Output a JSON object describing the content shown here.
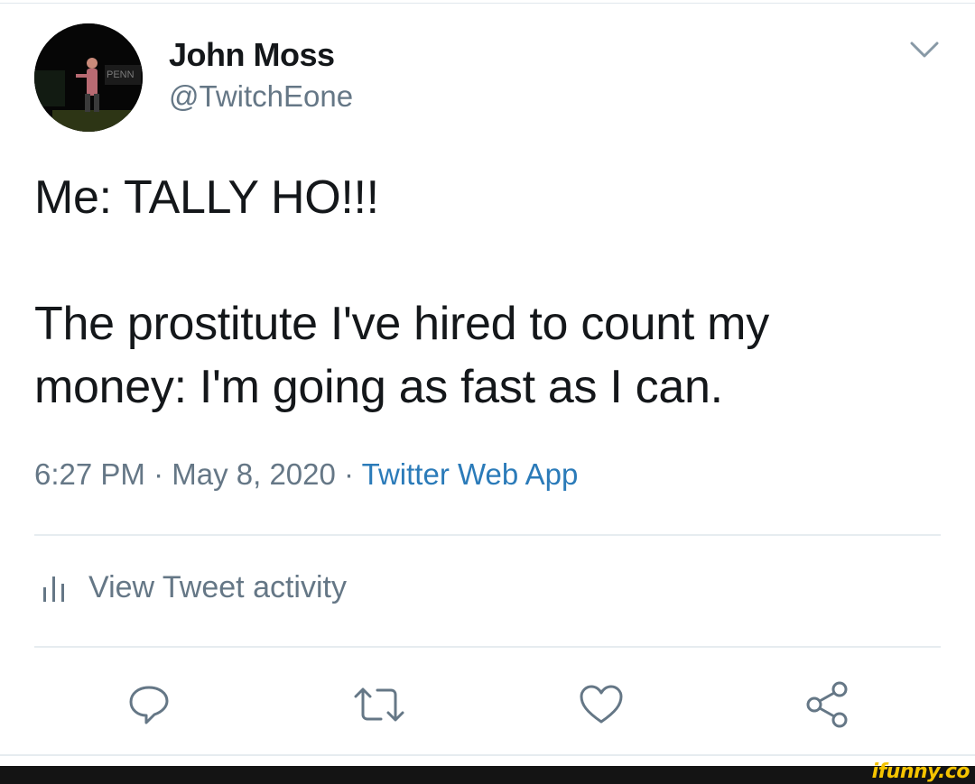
{
  "tweet": {
    "author": {
      "display_name": "John Moss",
      "handle": "@TwitchEone",
      "avatar_sign_text": "PENN"
    },
    "text": "Me: TALLY HO!!!\n\nThe prostitute I've hired to count my money: I'm going as fast as I can.",
    "time": "6:27 PM",
    "date": "May 8, 2020",
    "separator": "·",
    "source": "Twitter Web App",
    "activity_label": "View Tweet activity"
  },
  "actions": [
    {
      "name": "reply-icon"
    },
    {
      "name": "retweet-icon"
    },
    {
      "name": "like-icon"
    },
    {
      "name": "share-icon"
    }
  ],
  "watermark": "ifunny.co",
  "colors": {
    "text": "#14171a",
    "secondary": "#657786",
    "link": "#2b7bb9",
    "divider": "#e6ecf0",
    "watermark": "#f5c400"
  }
}
